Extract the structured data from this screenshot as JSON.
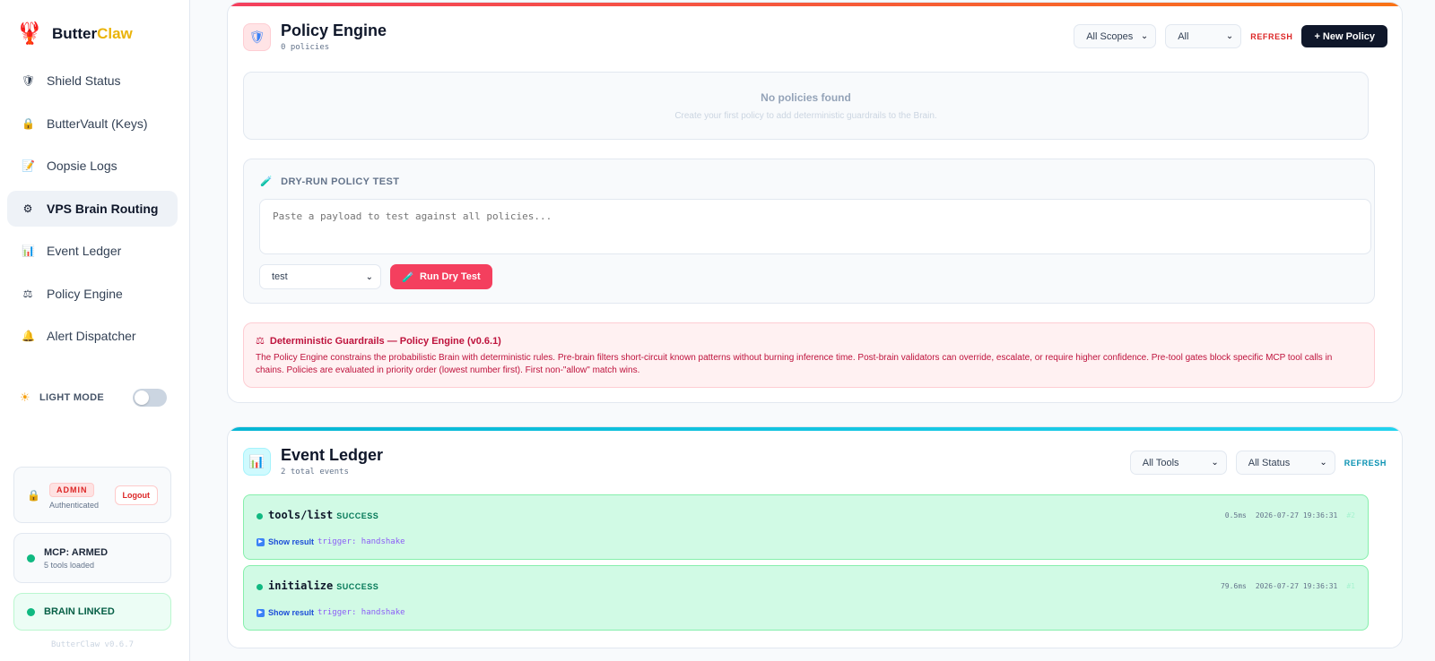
{
  "brand": {
    "name_main": "Butter",
    "name_accent": "Claw"
  },
  "sidebar": {
    "items": [
      {
        "label": "Shield Status",
        "icon": "shield-icon",
        "glyph": "🛡"
      },
      {
        "label": "ButterVault (Keys)",
        "icon": "lock-icon",
        "glyph": "🔒"
      },
      {
        "label": "Oopsie Logs",
        "icon": "memo-icon",
        "glyph": "📝"
      },
      {
        "label": "VPS Brain Routing",
        "icon": "gear-icon",
        "glyph": "⚙",
        "active": true
      },
      {
        "label": "Event Ledger",
        "icon": "bar-chart-icon",
        "glyph": "📊"
      },
      {
        "label": "Policy Engine",
        "icon": "scales-icon",
        "glyph": "⚖"
      },
      {
        "label": "Alert Dispatcher",
        "icon": "bell-icon",
        "glyph": "🔔"
      }
    ],
    "mode_label": "LIGHT MODE",
    "admin": {
      "badge": "ADMIN",
      "sub": "Authenticated",
      "logout": "Logout"
    },
    "mcp": {
      "title": "MCP: ARMED",
      "sub": "5 tools loaded"
    },
    "brain": {
      "title": "BRAIN LINKED"
    },
    "version": "ButterClaw v0.6.7"
  },
  "policy": {
    "title": "Policy Engine",
    "count": "0 policies",
    "scope_select": "All Scopes",
    "type_select": "All",
    "refresh": "REFRESH",
    "new_policy": "+ New Policy",
    "empty_title": "No policies found",
    "empty_sub": "Create your first policy to add deterministic guardrails to the Brain.",
    "dry_run": {
      "title": "DRY-RUN POLICY TEST",
      "placeholder": "Paste a payload to test against all policies...",
      "stage_select": "test",
      "run_button": "Run Dry Test"
    },
    "info": {
      "title": "Deterministic Guardrails — Policy Engine (v0.6.1)",
      "body": "The Policy Engine constrains the probabilistic Brain with deterministic rules. Pre-brain filters short-circuit known patterns without burning inference time. Post-brain validators can override, escalate, or require higher confidence. Pre-tool gates block specific MCP tool calls in chains. Policies are evaluated in priority order (lowest number first). First non-\"allow\" match wins."
    }
  },
  "ledger": {
    "title": "Event Ledger",
    "count": "2 total events",
    "tools_select": "All Tools",
    "status_select": "All Status",
    "refresh": "REFRESH",
    "events": [
      {
        "name": "tools/list",
        "status": "SUCCESS",
        "duration": "0.5ms",
        "timestamp": "2026-07-27 19:36:31",
        "seq": "#2",
        "show": "Show result",
        "trigger": "trigger: handshake"
      },
      {
        "name": "initialize",
        "status": "SUCCESS",
        "duration": "79.6ms",
        "timestamp": "2026-07-27 19:36:31",
        "seq": "#1",
        "show": "Show result",
        "trigger": "trigger: handshake"
      }
    ]
  },
  "colors": {
    "accent_policy": "#f43f5e",
    "accent_ledger": "#06b6d4",
    "success": "#10b981",
    "dark_button": "#0f172a"
  }
}
